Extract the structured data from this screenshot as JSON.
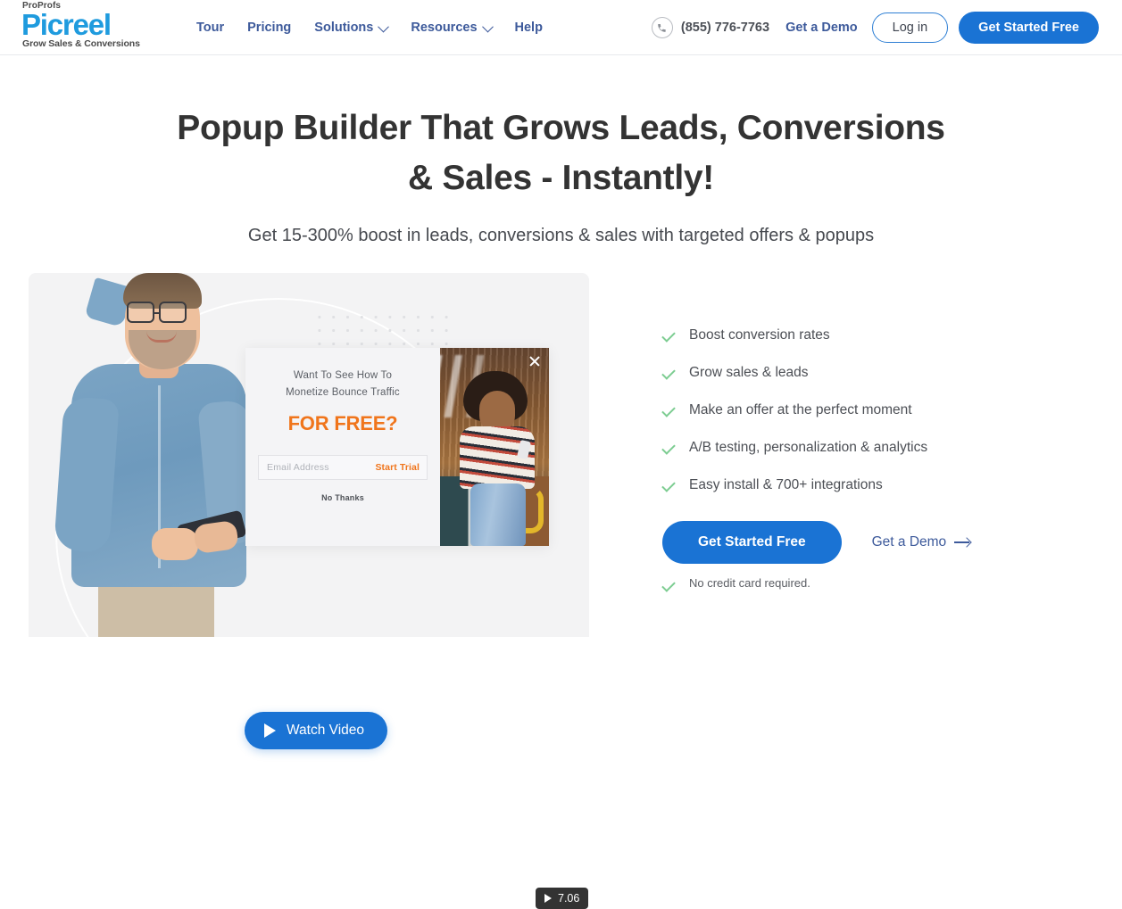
{
  "brand": {
    "parent": "ProProfs",
    "name": "Picreel",
    "tagline": "Grow Sales & Conversions",
    "accent_color": "#1f9bde"
  },
  "nav": {
    "items": [
      {
        "label": "Tour",
        "has_dropdown": false
      },
      {
        "label": "Pricing",
        "has_dropdown": false
      },
      {
        "label": "Solutions",
        "has_dropdown": true
      },
      {
        "label": "Resources",
        "has_dropdown": true
      },
      {
        "label": "Help",
        "has_dropdown": false
      }
    ]
  },
  "header": {
    "phone_icon": "phone-icon",
    "phone": "(855) 776-7763",
    "demo_link": "Get a Demo",
    "login_label": "Log in",
    "cta_label": "Get Started Free",
    "cta_color": "#1a73d4",
    "link_color": "#3d5a9b"
  },
  "hero": {
    "headline_line1": "Popup Builder That Grows Leads, Conversions",
    "headline_line2": "& Sales - Instantly!",
    "subheadline": "Get 15-300% boost in leads, conversions & sales with targeted offers & popups"
  },
  "media": {
    "watch_video_label": "Watch Video",
    "play_icon": "play-icon",
    "video_badge_time": "7.06",
    "video_badge_icon": "play-icon",
    "panel_bg": "#f3f3f4"
  },
  "popup_preview": {
    "headline_line1": "Want To See How To",
    "headline_line2": "Monetize Bounce Traffic",
    "emphasis": "FOR FREE?",
    "emphasis_color": "#f0751c",
    "email_placeholder": "Email Address",
    "email_value": "",
    "submit_label": "Start Trial",
    "dismiss_label": "No Thanks",
    "close_icon": "close-icon"
  },
  "benefits": {
    "check_icon": "check-icon",
    "check_color": "#7dcd92",
    "items": [
      "Boost conversion rates",
      "Grow sales & leads",
      "Make an offer at the perfect moment",
      "A/B testing, personalization & analytics",
      "Easy install & 700+ integrations"
    ]
  },
  "cta": {
    "primary_label": "Get Started Free",
    "secondary_label": "Get a Demo",
    "secondary_icon": "arrow-right-icon",
    "note": "No credit card required.",
    "note_icon": "check-icon"
  }
}
